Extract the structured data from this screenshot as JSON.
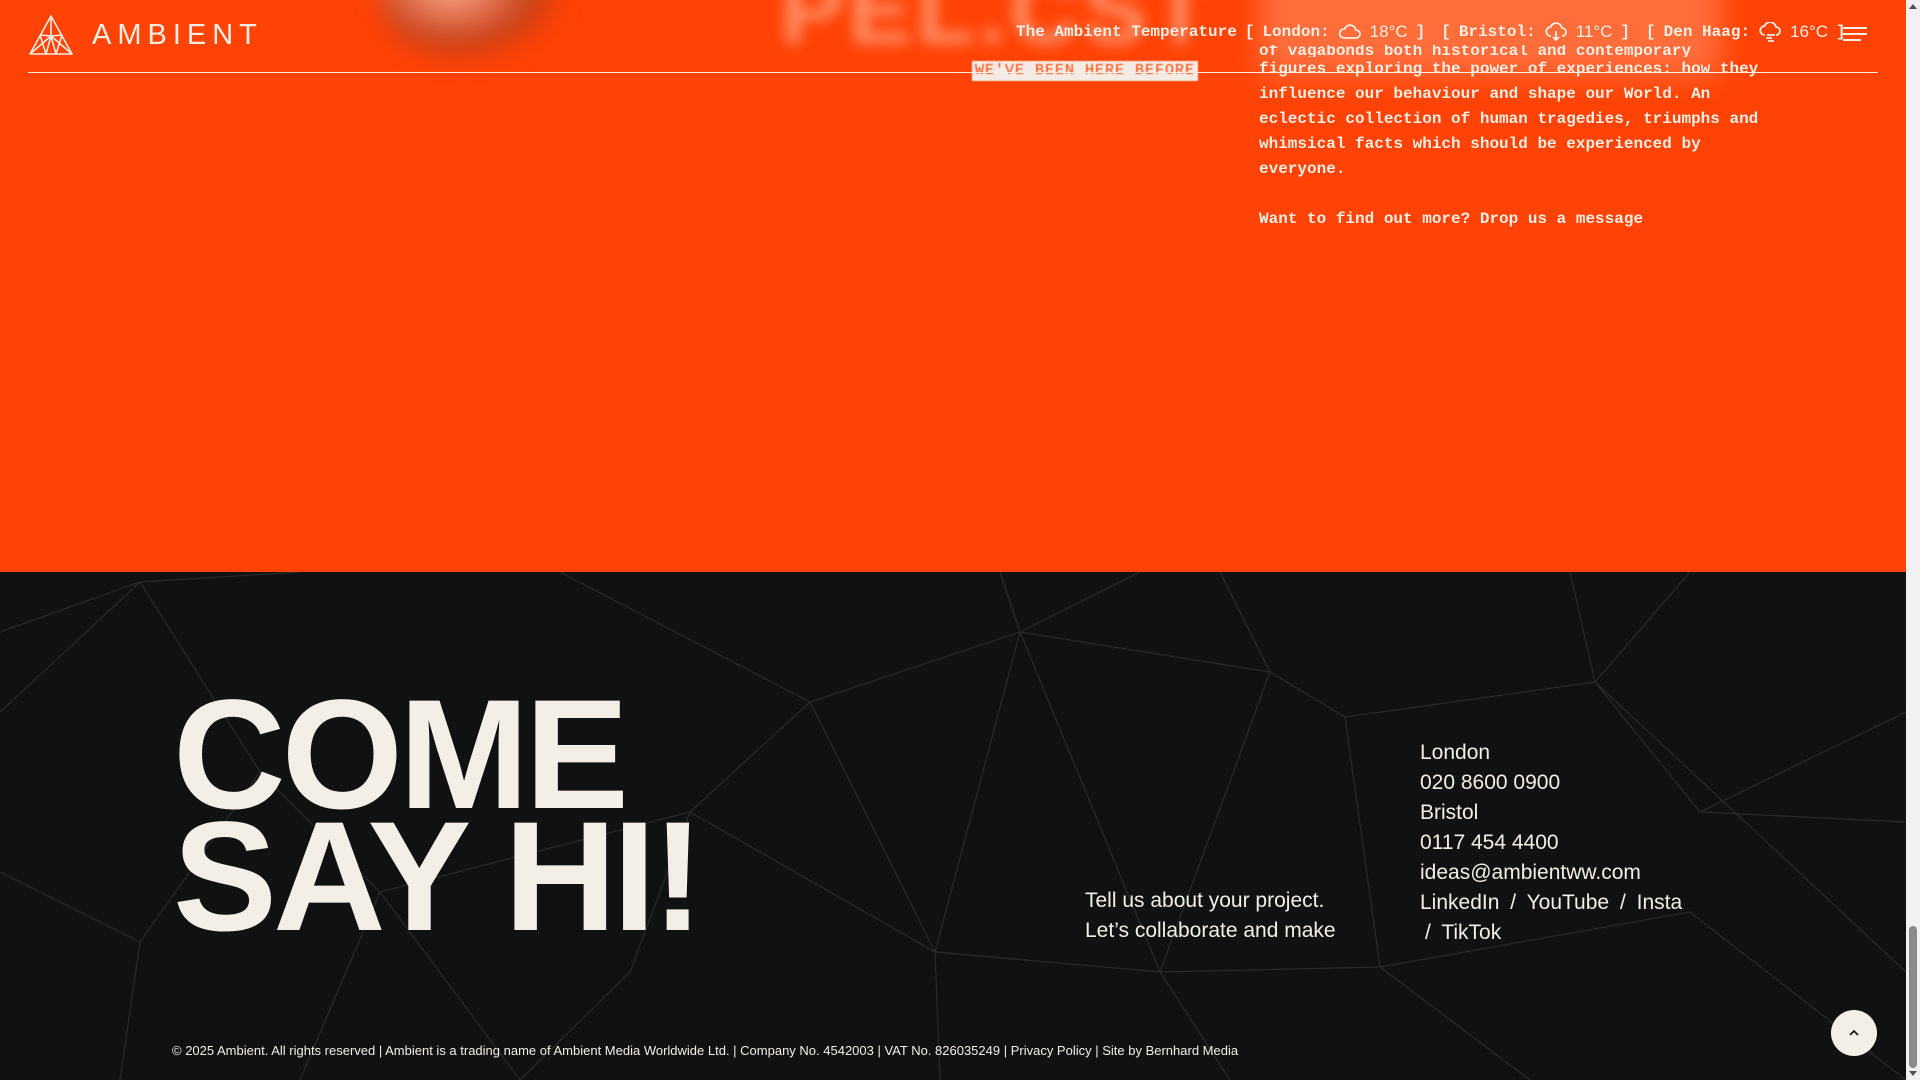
{
  "brand": {
    "name": "AMBIENT"
  },
  "header": {
    "weather_label": "The Ambient Temperature",
    "cities": [
      {
        "name": "London:",
        "temp": "18°C",
        "icon": "cloud-icon"
      },
      {
        "name": "Bristol:",
        "temp": "11°C",
        "icon": "cloud-download-icon"
      },
      {
        "name": "Den Haag:",
        "temp": "16°C",
        "icon": "cloud-rain-icon"
      }
    ],
    "bracket_open": "[",
    "bracket_close": "]",
    "menu_icon": "hamburger-menu-icon"
  },
  "hero": {
    "blurred_title": "PEL.CST",
    "tag": "WE'VE BEEN HERE BEFORE",
    "about_cut_line": "of vagabonds both historical and contemporary",
    "about_lines": "figures exploring the power of experiences: how they influence our behaviour and shape our World. An eclectic collection of human tragedies, triumphs and whimsical facts which should be experienced by everyone.",
    "cta": "Want to find out more? Drop us a message"
  },
  "footer": {
    "title_line1": "COME",
    "title_line2": "SAY HI!",
    "tell_line1": "Tell us about your project.",
    "tell_line2": "Let’s collaborate and make",
    "contact": {
      "city1": "London",
      "phone1": "020 8600 0900",
      "city2": "Bristol",
      "phone2": "0117 454 4400",
      "email": "ideas@ambientww.com",
      "social": [
        "LinkedIn",
        "YouTube",
        "Insta",
        "TikTok"
      ],
      "social_sep": "/"
    },
    "copyright": "© 2025 Ambient. All rights reserved | Ambient is a trading name of Ambient Media Worldwide Ltd. | Company No. 4542003 | VAT No. 826035249 | ",
    "privacy": "Privacy Policy",
    "site_by": " | Site by Bernhard Media",
    "to_top_icon": "chevron-up-icon"
  },
  "colors": {
    "orange": "#ff4306",
    "dark": "#111111",
    "cream": "#f3efe6"
  }
}
